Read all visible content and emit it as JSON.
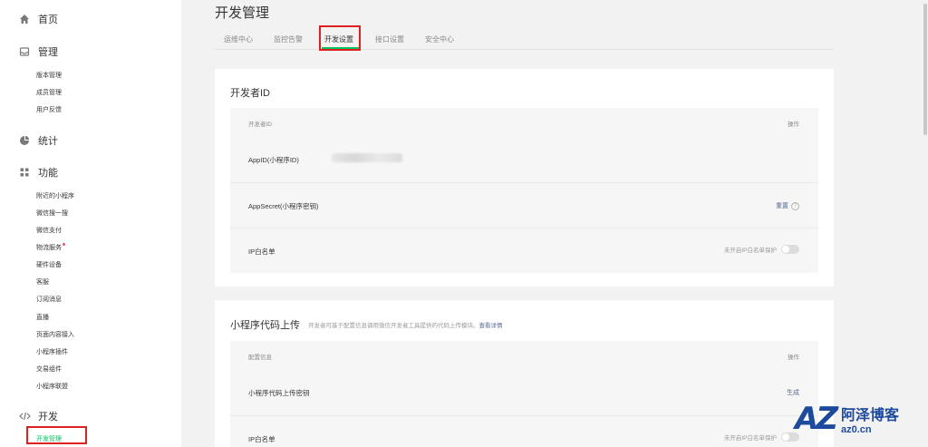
{
  "sidebar": {
    "home": "首页",
    "manage": {
      "label": "管理",
      "items": [
        "版本管理",
        "成员管理",
        "用户反馈"
      ]
    },
    "stats": "统计",
    "features": {
      "label": "功能",
      "items": [
        "附近的小程序",
        "微信搜一搜",
        "微信支付",
        "物流服务",
        "硬件设备",
        "客服",
        "订阅消息",
        "直播",
        "页面内容接入",
        "小程序插件",
        "交易组件",
        "小程序联盟"
      ]
    },
    "dev": {
      "label": "开发",
      "items": [
        "开发管理"
      ]
    }
  },
  "page": {
    "title": "开发管理"
  },
  "tabs": [
    "运维中心",
    "监控告警",
    "开发设置",
    "接口设置",
    "安全中心"
  ],
  "active_tab": "开发设置",
  "developer_id": {
    "title": "开发者ID",
    "header": {
      "col1": "开发者ID",
      "col2": "操作"
    },
    "rows": [
      {
        "label": "AppID(小程序ID)"
      },
      {
        "label": "AppSecret(小程序密钥)",
        "action": "重置"
      },
      {
        "label": "IP白名单",
        "status": "未开启IP白名单保护"
      }
    ]
  },
  "code_upload": {
    "title": "小程序代码上传",
    "desc": "开发者可基于配置信息调用微信开发者工具提供的代码上传模块。",
    "desc_link": "查看详情",
    "header": {
      "col1": "配置信息",
      "col2": "操作"
    },
    "rows": [
      {
        "label": "小程序代码上传密钥",
        "action": "生成"
      },
      {
        "label": "IP白名单",
        "status": "未开启IP白名单保护"
      }
    ]
  },
  "watermark": {
    "logo": "AZ",
    "name": "阿泽博客",
    "domain": "az0.cn"
  },
  "colors": {
    "accent": "#07c160",
    "link": "#576b95",
    "highlight": "#e02020",
    "badge": "#fa5151"
  }
}
